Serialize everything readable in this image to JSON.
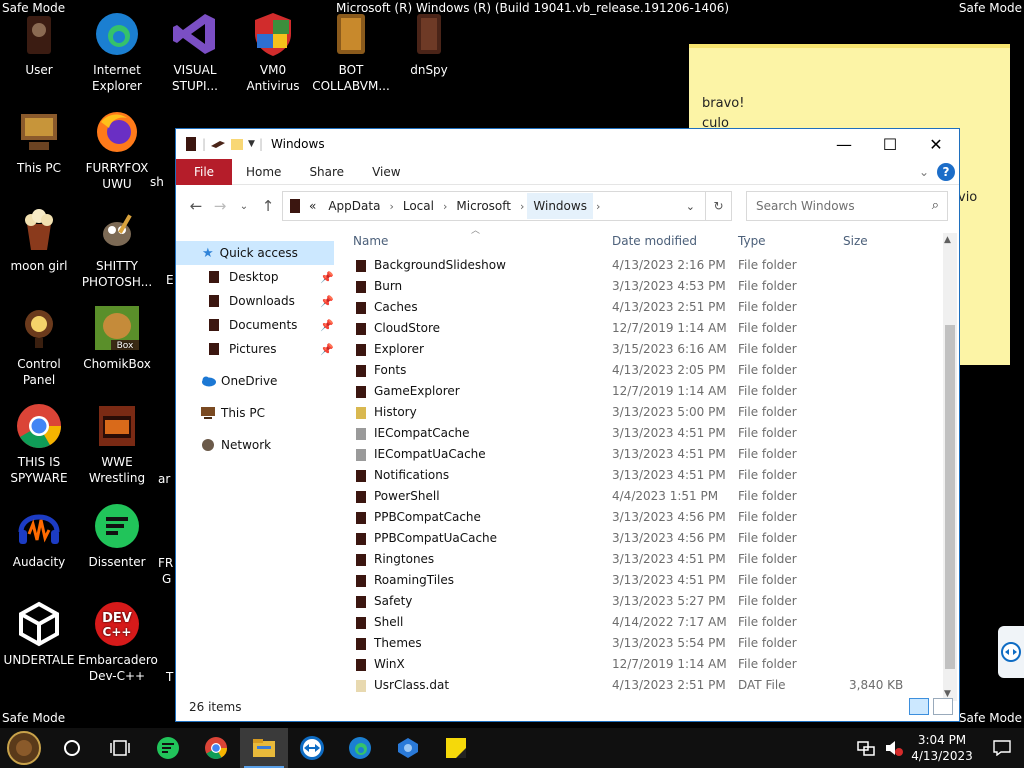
{
  "desktop": {
    "safe_mode_label": "Safe Mode",
    "build_info": "Microsoft (R) Windows (R) (Build 19041.vb_release.191206-1406)",
    "icons": [
      {
        "label": "User",
        "icon": "folder-person-icon"
      },
      {
        "label": "Internet Explorer",
        "icon": "edge-browser-icon"
      },
      {
        "label": "VISUAL STUPI...",
        "icon": "visual-studio-icon"
      },
      {
        "label": "VM0 Antivirus",
        "icon": "shield-icon"
      },
      {
        "label": "BOT COLLABVM...",
        "icon": "folder-icon"
      },
      {
        "label": "dnSpy",
        "icon": "folder-icon"
      },
      {
        "label": "This PC",
        "icon": "computer-icon"
      },
      {
        "label": "FURRYFOX UWU",
        "icon": "firefox-icon"
      },
      {
        "label": "moon girl",
        "icon": "popcorn-icon"
      },
      {
        "label": "SHITTY PHOTOSH...",
        "icon": "gimp-icon"
      },
      {
        "label": "Control Panel",
        "icon": "lamp-icon"
      },
      {
        "label": "ChomikBox",
        "icon": "chomikbox-icon"
      },
      {
        "label": "THIS IS SPYWARE",
        "icon": "chrome-icon"
      },
      {
        "label": "WWE Wrestling",
        "icon": "oven-icon"
      },
      {
        "label": "Audacity",
        "icon": "audacity-icon"
      },
      {
        "label": "Dissenter",
        "icon": "dissenter-icon"
      },
      {
        "label": "UNDERTALE",
        "icon": "unity-icon"
      },
      {
        "label": "Embarcadero Dev-C++",
        "icon": "devcpp-icon"
      }
    ],
    "partial_labels": [
      "sh",
      "E",
      "ar",
      "FR",
      "G",
      "T"
    ]
  },
  "sticky_note": {
    "lines": [
      "bravo!",
      "culo"
    ],
    "fragment": "vio",
    "color": "#fcf4a6"
  },
  "explorer": {
    "title": "Windows",
    "ribbon_tabs": [
      "File",
      "Home",
      "Share",
      "View"
    ],
    "breadcrumb": [
      "AppData",
      "Local",
      "Microsoft",
      "Windows"
    ],
    "breadcrumb_overflow": "«",
    "search_placeholder": "Search Windows",
    "nav": {
      "quick_access": "Quick access",
      "quick_items": [
        "Desktop",
        "Downloads",
        "Documents",
        "Pictures"
      ],
      "onedrive": "OneDrive",
      "this_pc": "This PC",
      "network": "Network"
    },
    "columns": {
      "name": "Name",
      "date": "Date modified",
      "type": "Type",
      "size": "Size"
    },
    "files": [
      {
        "name": "BackgroundSlideshow",
        "date": "4/13/2023 2:16 PM",
        "type": "File folder",
        "size": "",
        "icon": "folder-dark-icon"
      },
      {
        "name": "Burn",
        "date": "3/13/2023 4:53 PM",
        "type": "File folder",
        "size": "",
        "icon": "folder-dark-icon"
      },
      {
        "name": "Caches",
        "date": "4/13/2023 2:51 PM",
        "type": "File folder",
        "size": "",
        "icon": "folder-dark-icon"
      },
      {
        "name": "CloudStore",
        "date": "12/7/2019 1:14 AM",
        "type": "File folder",
        "size": "",
        "icon": "folder-dark-icon"
      },
      {
        "name": "Explorer",
        "date": "3/15/2023 6:16 AM",
        "type": "File folder",
        "size": "",
        "icon": "folder-dark-icon"
      },
      {
        "name": "Fonts",
        "date": "4/13/2023 2:05 PM",
        "type": "File folder",
        "size": "",
        "icon": "folder-dark-icon"
      },
      {
        "name": "GameExplorer",
        "date": "12/7/2019 1:14 AM",
        "type": "File folder",
        "size": "",
        "icon": "folder-dark-icon"
      },
      {
        "name": "History",
        "date": "3/13/2023 5:00 PM",
        "type": "File folder",
        "size": "",
        "icon": "history-folder-icon"
      },
      {
        "name": "IECompatCache",
        "date": "3/13/2023 4:51 PM",
        "type": "File folder",
        "size": "",
        "icon": "folder-gray-icon"
      },
      {
        "name": "IECompatUaCache",
        "date": "3/13/2023 4:51 PM",
        "type": "File folder",
        "size": "",
        "icon": "folder-gray-icon"
      },
      {
        "name": "Notifications",
        "date": "3/13/2023 4:51 PM",
        "type": "File folder",
        "size": "",
        "icon": "folder-dark-icon"
      },
      {
        "name": "PowerShell",
        "date": "4/4/2023 1:51 PM",
        "type": "File folder",
        "size": "",
        "icon": "folder-dark-icon"
      },
      {
        "name": "PPBCompatCache",
        "date": "3/13/2023 4:56 PM",
        "type": "File folder",
        "size": "",
        "icon": "folder-dark-icon"
      },
      {
        "name": "PPBCompatUaCache",
        "date": "3/13/2023 4:56 PM",
        "type": "File folder",
        "size": "",
        "icon": "folder-dark-icon"
      },
      {
        "name": "Ringtones",
        "date": "3/13/2023 4:51 PM",
        "type": "File folder",
        "size": "",
        "icon": "folder-dark-icon"
      },
      {
        "name": "RoamingTiles",
        "date": "3/13/2023 4:51 PM",
        "type": "File folder",
        "size": "",
        "icon": "folder-dark-icon"
      },
      {
        "name": "Safety",
        "date": "3/13/2023 5:27 PM",
        "type": "File folder",
        "size": "",
        "icon": "folder-dark-icon"
      },
      {
        "name": "Shell",
        "date": "4/14/2022 7:17 AM",
        "type": "File folder",
        "size": "",
        "icon": "folder-dark-icon"
      },
      {
        "name": "Themes",
        "date": "3/13/2023 5:54 PM",
        "type": "File folder",
        "size": "",
        "icon": "folder-dark-icon"
      },
      {
        "name": "WinX",
        "date": "12/7/2019 1:14 AM",
        "type": "File folder",
        "size": "",
        "icon": "folder-dark-icon"
      },
      {
        "name": "UsrClass.dat",
        "date": "4/13/2023 2:51 PM",
        "type": "DAT File",
        "size": "3,840 KB",
        "icon": "file-icon"
      }
    ],
    "status": "26 items",
    "accent": "#b51d2a"
  },
  "taskbar": {
    "time": "3:04 PM",
    "date": "4/13/2023",
    "items": [
      "start-icon",
      "cortana-icon",
      "task-view-icon",
      "dissenter-icon",
      "chrome-icon",
      "file-explorer-icon",
      "teamviewer-icon",
      "edge-icon",
      "app-icon",
      "sticky-notes-icon"
    ]
  }
}
